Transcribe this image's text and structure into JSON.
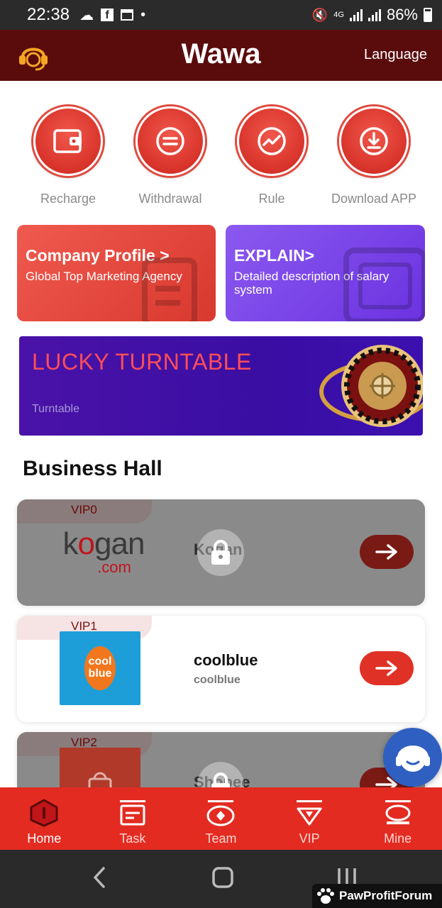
{
  "status_bar": {
    "time": "22:38",
    "battery": "86%",
    "network": "4G"
  },
  "header": {
    "title": "Wawa",
    "language": "Language"
  },
  "quick_actions": [
    {
      "label": "Recharge",
      "icon": "wallet-icon"
    },
    {
      "label": "Withdrawal",
      "icon": "withdrawal-icon"
    },
    {
      "label": "Rule",
      "icon": "trend-icon"
    },
    {
      "label": "Download APP",
      "icon": "download-icon"
    }
  ],
  "promos": {
    "company": {
      "title": "Company Profile >",
      "subtitle": "Global Top Marketing Agency"
    },
    "explain": {
      "title": "EXPLAIN>",
      "subtitle": "Detailed description of salary system"
    }
  },
  "lucky": {
    "title": "LUCKY TURNTABLE",
    "subtitle": "Turntable"
  },
  "business_hall": {
    "title": "Business Hall",
    "items": [
      {
        "vip": "VIP0",
        "name": "Kogan",
        "sub": "",
        "logo": "kogan",
        "locked": true
      },
      {
        "vip": "VIP1",
        "name": "coolblue",
        "sub": "coolblue",
        "logo": "coolblue",
        "locked": false
      },
      {
        "vip": "VIP2",
        "name": "Shopee",
        "sub": "",
        "logo": "shopee",
        "locked": true
      }
    ]
  },
  "bottom_nav": [
    {
      "label": "Home",
      "icon": "home-icon",
      "active": true
    },
    {
      "label": "Task",
      "icon": "task-icon",
      "active": false
    },
    {
      "label": "Team",
      "icon": "team-icon",
      "active": false
    },
    {
      "label": "VIP",
      "icon": "vip-icon",
      "active": false
    },
    {
      "label": "Mine",
      "icon": "mine-icon",
      "active": false
    }
  ],
  "watermark": "PawProfitForum",
  "colors": {
    "header": "#5a0c0c",
    "accent": "#e32b21",
    "purple": "#6b32e0"
  }
}
